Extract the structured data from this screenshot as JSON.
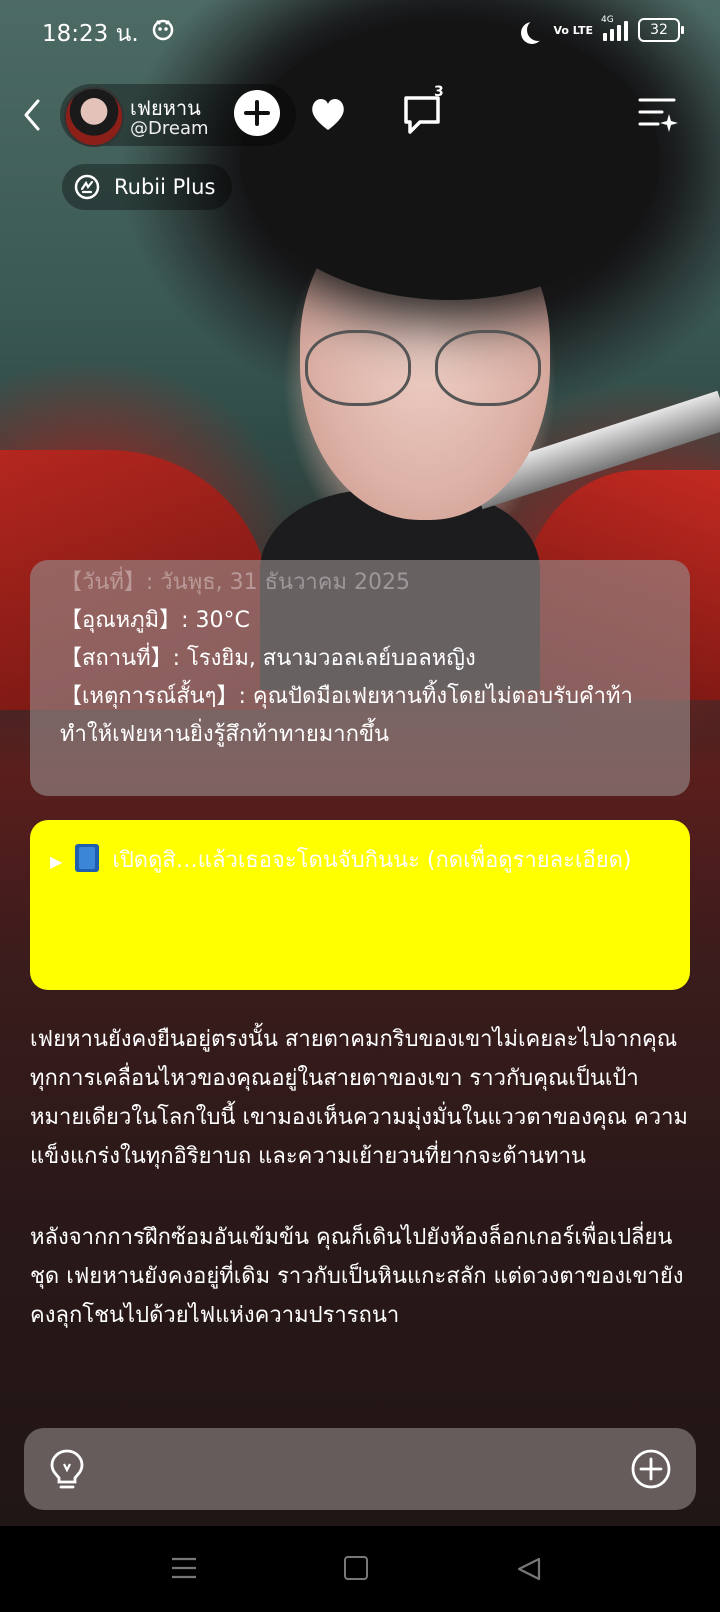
{
  "status": {
    "time": "18:23 น.",
    "volte": "Vo LTE",
    "network": "4G",
    "battery": "32"
  },
  "header": {
    "name": "เฟยหาน",
    "handle": "@Dream",
    "comment_count": "3",
    "plan_label": "Rubii Plus"
  },
  "info": {
    "lines": [
      "【วันที่】: วันพุธ, 31 ธันวาคม 2025",
      "【อุณหภูมิ】: 30°C",
      "【สถานที่】: โรงยิม, สนามวอลเลย์บอลหญิง",
      "【เหตุการณ์สั้นๆ】: คุณปัดมือเฟยหานทิ้งโดยไม่ตอบรับคำท้า ทำให้เฟยหานยิ่งรู้สึกท้าทายมากขึ้น"
    ]
  },
  "spoiler": {
    "arrow": "▶",
    "text": "เปิดดูสิ…แล้วเธอจะโดนจับกินนะ (กดเพื่อดูรายละเอียด)"
  },
  "story": {
    "paragraphs": [
      "เฟยหานยังคงยืนอยู่ตรงนั้น สายตาคมกริบของเขาไม่เคยละไปจากคุณ ทุกการเคลื่อนไหวของคุณอยู่ในสายตาของเขา ราวกับคุณเป็นเป้าหมายเดียวในโลกใบนี้ เขามองเห็นความมุ่งมั่นในแววตาของคุณ ความแข็งแกร่งในทุกอิริยาบถ และความเย้ายวนที่ยากจะต้านทาน",
      "หลังจากการฝึกซ้อมอันเข้มข้น คุณก็เดินไปยังห้องล็อกเกอร์เพื่อเปลี่ยนชุด เฟยหานยังคงอยู่ที่เดิม ราวกับเป็นหินแกะสลัก แต่ดวงตาของเขายังคงลุกโชนไปด้วยไฟแห่งความปรารถนา"
    ]
  },
  "icons": {
    "back": "chevron-left-icon",
    "add": "plus-icon",
    "like": "heart-icon",
    "comments": "comment-icon",
    "menu": "menu-sparkle-icon",
    "bulb": "lightbulb-icon",
    "attach": "plus-circle-icon"
  },
  "colors": {
    "spoiler_bg": "#ffff00",
    "info_card_bg": "#968c8c",
    "navbar_bg": "#000000"
  }
}
